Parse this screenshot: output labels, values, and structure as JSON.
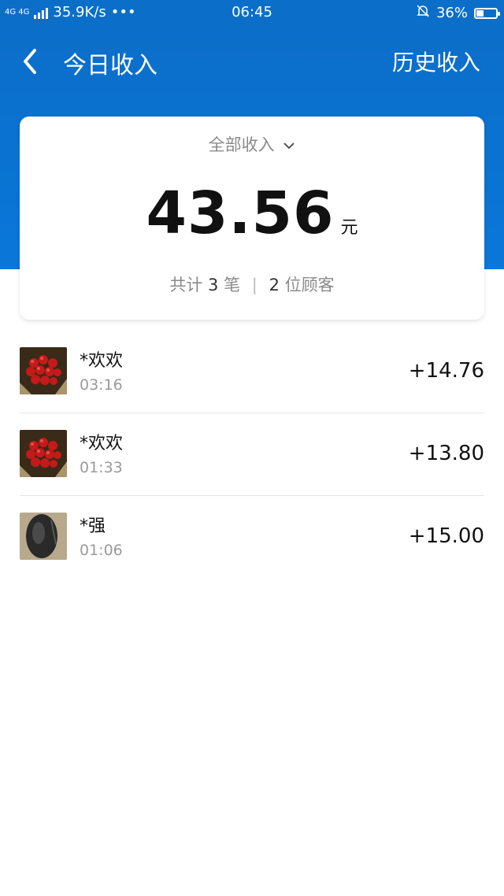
{
  "status_bar": {
    "network": "4G 4G",
    "speed": "35.9K/s",
    "dots": "•••",
    "time": "06:45",
    "battery_percent": "36%",
    "battery_level": 0.36
  },
  "header": {
    "title": "今日收入",
    "history_link": "历史收入",
    "background": "#0b6ec9"
  },
  "summary": {
    "filter_label": "全部收入",
    "total": "43.56",
    "unit": "元",
    "count_prefix": "共计",
    "count": "3",
    "count_suffix": "笔",
    "separator": "|",
    "customers": "2",
    "customers_suffix": "位顾客"
  },
  "transactions": [
    {
      "name": "*欢欢",
      "time": "03:16",
      "amount": "+14.76",
      "avatar": "red-flowers-avatar"
    },
    {
      "name": "*欢欢",
      "time": "01:33",
      "amount": "+13.80",
      "avatar": "red-flowers-avatar"
    },
    {
      "name": "*强",
      "time": "01:06",
      "amount": "+15.00",
      "avatar": "dark-object-avatar"
    }
  ]
}
